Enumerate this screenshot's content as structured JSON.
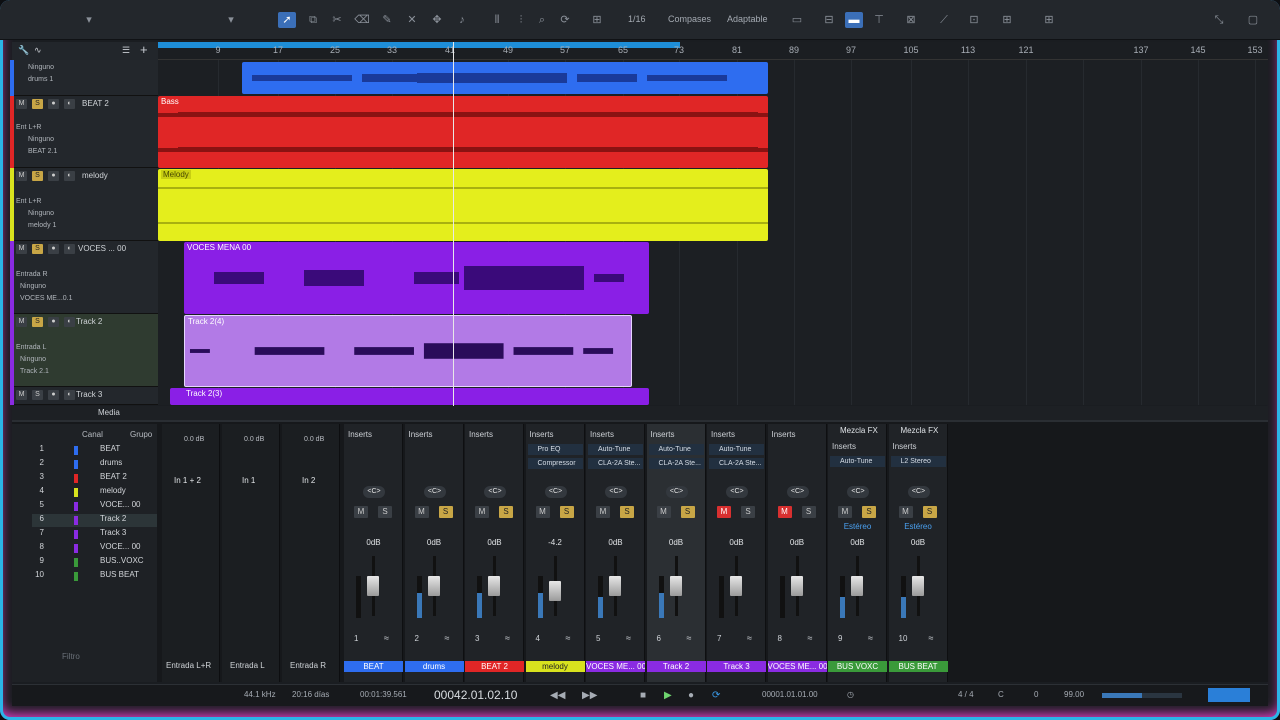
{
  "toolbar": {
    "quantize": "1/16",
    "timebase": "Compases",
    "snap": "Adaptable"
  },
  "ruler": {
    "bars": [
      "9",
      "17",
      "25",
      "33",
      "41",
      "49",
      "57",
      "65",
      "73",
      "81",
      "89",
      "97",
      "105",
      "113",
      "121",
      "137",
      "145",
      "153"
    ]
  },
  "tracks": [
    {
      "name": "",
      "rows": [
        "Ninguno",
        "drums 1"
      ],
      "color": "#2e6df0"
    },
    {
      "name": "BEAT 2",
      "rows": [
        "Ent L+R",
        "Ninguno",
        "BEAT 2.1"
      ],
      "color": "#e02626"
    },
    {
      "name": "melody",
      "rows": [
        "Ent L+R",
        "Ninguno",
        "melody 1"
      ],
      "color": "#d8e21e"
    },
    {
      "name": "VOCES ... 00",
      "rows": [
        "Entrada R",
        "Ninguno",
        "VOCES ME...0.1"
      ],
      "color": "#8a2be2"
    },
    {
      "name": "Track 2",
      "rows": [
        "Entrada L",
        "Ninguno",
        "Track 2.1"
      ],
      "color": "#8a2be2"
    },
    {
      "name": "Track 3",
      "rows": [],
      "color": "#8a2be2"
    }
  ],
  "clips": {
    "bass": "Bass",
    "melody": "Melody",
    "voces": "VOCES MENA  00",
    "track2": "Track 2(4)",
    "track3": "Track 2(3)"
  },
  "mixer": {
    "tab_media": "Media",
    "channel_list": {
      "col_channel": "Canal",
      "col_group": "Grupo",
      "filter_placeholder": "Filtro",
      "rows": [
        {
          "num": "1",
          "name": "BEAT",
          "color": "#2e6df0"
        },
        {
          "num": "2",
          "name": "drums",
          "color": "#2e6df0"
        },
        {
          "num": "3",
          "name": "BEAT 2",
          "color": "#e02626"
        },
        {
          "num": "4",
          "name": "melody",
          "color": "#d8e21e"
        },
        {
          "num": "5",
          "name": "VOCE... 00",
          "color": "#8a2be2"
        },
        {
          "num": "6",
          "name": "Track 2",
          "color": "#8a2be2"
        },
        {
          "num": "7",
          "name": "Track 3",
          "color": "#8a2be2"
        },
        {
          "num": "8",
          "name": "VOCE... 00",
          "color": "#8a2be2"
        },
        {
          "num": "9",
          "name": "BUS..VOXC",
          "color": "#3a9a3a"
        },
        {
          "num": "10",
          "name": "BUS BEAT",
          "color": "#3a9a3a"
        }
      ]
    },
    "inputs": [
      {
        "gain": "0.0 dB",
        "name": "In 1 + 2",
        "label": "Entrada L+R"
      },
      {
        "gain": "0.0 dB",
        "name": "In 1",
        "label": "Entrada L"
      },
      {
        "gain": "0.0 dB",
        "name": "In 2",
        "label": "Entrada R"
      }
    ],
    "channels": [
      {
        "num": "1",
        "label": "BEAT",
        "color": "#2e6df0",
        "inserts": "Inserts",
        "plugins": [],
        "vol": "0dB",
        "pan": "<C>",
        "m": false,
        "s": false,
        "fader": 0.6,
        "meter": 0.0
      },
      {
        "num": "2",
        "label": "drums",
        "color": "#2e6df0",
        "inserts": "Inserts",
        "plugins": [],
        "vol": "0dB",
        "pan": "<C>",
        "m": false,
        "s": true,
        "fader": 0.6,
        "meter": 0.6
      },
      {
        "num": "3",
        "label": "BEAT 2",
        "color": "#e02626",
        "inserts": "Inserts",
        "plugins": [],
        "vol": "0dB",
        "pan": "<C>",
        "m": false,
        "s": true,
        "fader": 0.6,
        "meter": 0.6
      },
      {
        "num": "4",
        "label": "melody",
        "color": "#d8e21e",
        "inserts": "Inserts",
        "plugins": [
          "Pro EQ",
          "Compressor"
        ],
        "vol": "-4.2",
        "pan": "<C>",
        "m": false,
        "s": true,
        "fader": 0.5,
        "meter": 0.6
      },
      {
        "num": "5",
        "label": "VOCES ME... 00",
        "color": "#8a2be2",
        "inserts": "Inserts",
        "plugins": [
          "Auto-Tune",
          "CLA-2A Ste..."
        ],
        "vol": "0dB",
        "pan": "<C>",
        "m": false,
        "s": true,
        "fader": 0.6,
        "meter": 0.5
      },
      {
        "num": "6",
        "label": "Track 2",
        "color": "#8a2be2",
        "inserts": "Inserts",
        "plugins": [
          "Auto-Tune",
          "CLA-2A Ste..."
        ],
        "vol": "0dB",
        "pan": "<C>",
        "m": false,
        "s": true,
        "fader": 0.6,
        "meter": 0.6
      },
      {
        "num": "7",
        "label": "Track 3",
        "color": "#8a2be2",
        "inserts": "Inserts",
        "plugins": [
          "Auto-Tune",
          "CLA-2A Ste..."
        ],
        "vol": "0dB",
        "pan": "<C>",
        "m": true,
        "s": false,
        "fader": 0.6,
        "meter": 0.0
      },
      {
        "num": "8",
        "label": "VOCES ME... 00",
        "color": "#8a2be2",
        "inserts": "Inserts",
        "plugins": [],
        "vol": "0dB",
        "pan": "<C>",
        "m": true,
        "s": false,
        "fader": 0.6,
        "meter": 0.0
      },
      {
        "num": "9",
        "label": "BUS VOXC",
        "color": "#3a9a3a",
        "inserts": "Inserts",
        "plugins": [
          "Auto-Tune"
        ],
        "vol": "0dB",
        "pan": "<C>",
        "m": false,
        "s": true,
        "fader": 0.6,
        "meter": 0.5,
        "header": "Mezcla FX",
        "mode": "Estéreo"
      },
      {
        "num": "10",
        "label": "BUS BEAT",
        "color": "#3a9a3a",
        "inserts": "Inserts",
        "plugins": [
          "L2 Stereo"
        ],
        "vol": "0dB",
        "pan": "<C>",
        "m": false,
        "s": true,
        "fader": 0.6,
        "meter": 0.5,
        "header": "Mezcla FX",
        "mode": "Estéreo"
      }
    ]
  },
  "status": {
    "samplerate": "44.1 kHz",
    "record_time": "20:16 días",
    "time": "00:01:39.561",
    "position": "00042.01.02.10",
    "loop_start": "00001.01.01.00",
    "signature": "4 / 4",
    "key": "C",
    "offset": "0",
    "tempo": "99.00"
  }
}
